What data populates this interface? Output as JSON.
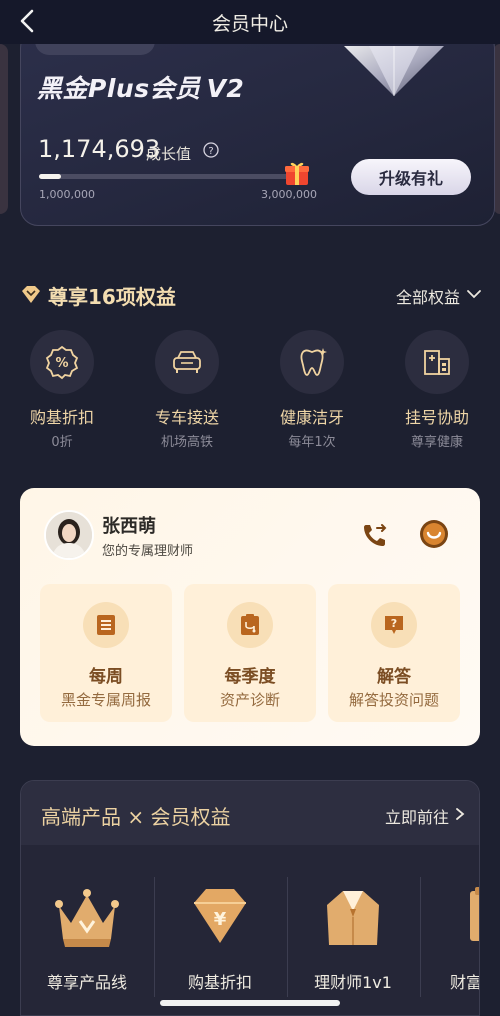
{
  "header": {
    "title": "会员中心",
    "back_icon": "back-chevron-icon"
  },
  "member": {
    "level_name": "黑金Plus会员",
    "level_badge": "V2",
    "growth_value": "1,174,693",
    "growth_label": "成长值",
    "progress_min": "1,000,000",
    "progress_max": "3,000,000",
    "progress_fraction": 0.087,
    "upgrade_label": "升级有礼"
  },
  "benefits": {
    "title": "尊享16项权益",
    "all_label": "全部权益",
    "items": [
      {
        "name": "购基折扣",
        "sub": "0折",
        "icon": "percent-badge-icon"
      },
      {
        "name": "专车接送",
        "sub": "机场高铁",
        "icon": "car-icon"
      },
      {
        "name": "健康洁牙",
        "sub": "每年1次",
        "icon": "tooth-icon"
      },
      {
        "name": "挂号协助",
        "sub": "尊享健康",
        "icon": "hospital-icon"
      }
    ]
  },
  "advisor": {
    "name": "张西萌",
    "role": "您的专属理财师",
    "services": [
      {
        "title": "每周",
        "desc": "黑金专属周报",
        "icon": "report-icon"
      },
      {
        "title": "每季度",
        "desc": "资产诊断",
        "icon": "diagnosis-icon"
      },
      {
        "title": "解答",
        "desc": "解答投资问题",
        "icon": "question-icon"
      }
    ]
  },
  "products": {
    "title": "高端产品 × 会员权益",
    "goto_label": "立即前往",
    "items": [
      {
        "name": "尊享产品线",
        "icon": "crown-icon"
      },
      {
        "name": "购基折扣",
        "icon": "diamond-yen-icon"
      },
      {
        "name": "理财师1v1",
        "icon": "suit-icon"
      },
      {
        "name": "财富",
        "icon": "document-icon"
      }
    ]
  },
  "colors": {
    "gold": "#f3ddb0",
    "background": "#1d2030",
    "advisor_bg": "#fff6e7"
  }
}
